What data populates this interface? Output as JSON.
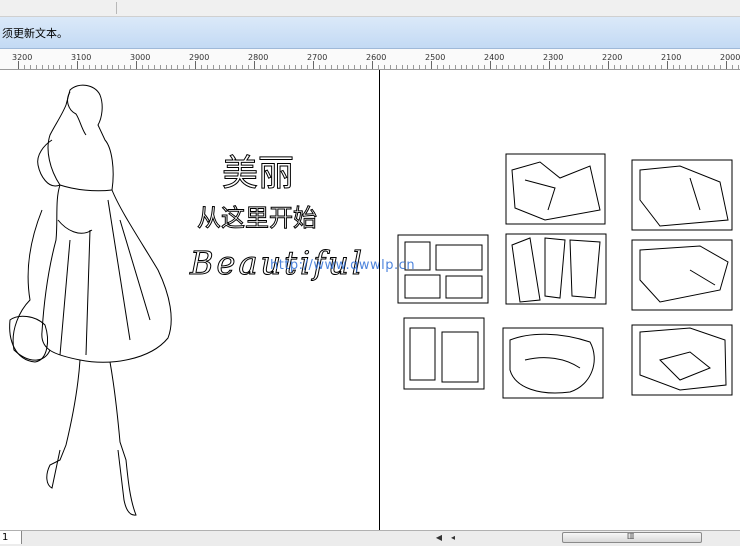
{
  "infobar": {
    "message": "须更新文本。"
  },
  "ruler": {
    "labels": [
      "3200",
      "3100",
      "3000",
      "2900",
      "2800",
      "2700",
      "2600",
      "2500",
      "2400",
      "2300",
      "2200",
      "2100",
      "2000"
    ]
  },
  "artwork": {
    "title_cn": "美丽",
    "subtitle_cn": "从这里开始",
    "script_text": "Beautiful",
    "watermark": "http://www.qwwlp.cn"
  },
  "statusbar": {
    "page_tab": "1"
  },
  "colors": {
    "infobar": "#c3daf4",
    "watermark": "#2f6fd6"
  }
}
